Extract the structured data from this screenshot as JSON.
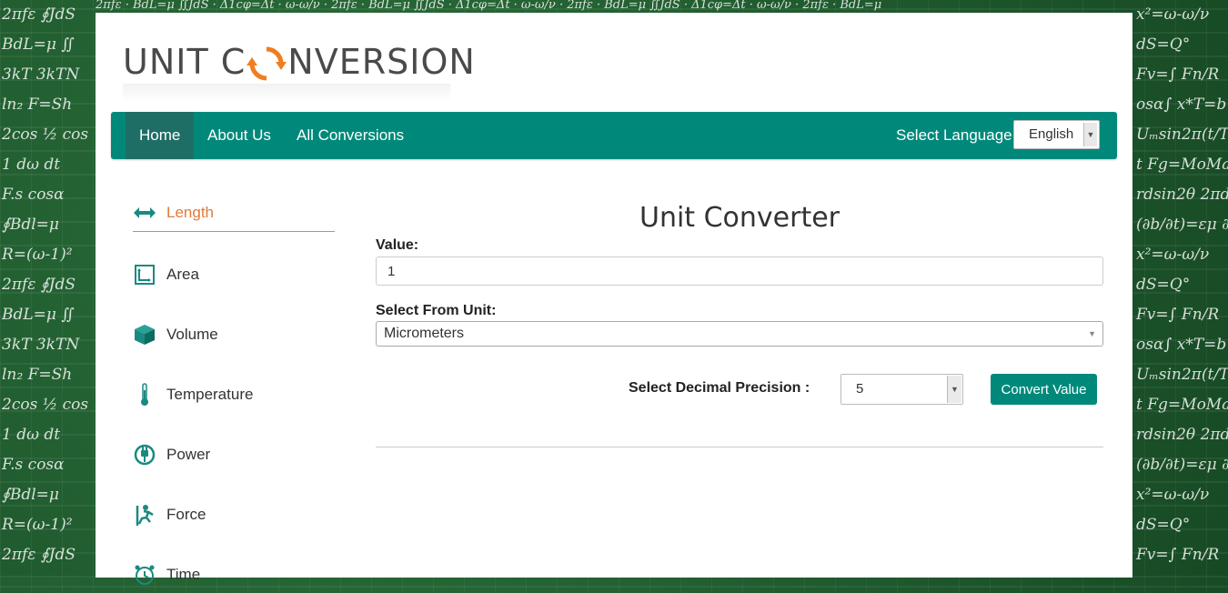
{
  "logo": {
    "text_before": "UNIT C",
    "text_after": "NVERSION"
  },
  "navbar": {
    "items": [
      {
        "label": "Home",
        "active": true
      },
      {
        "label": "About Us"
      },
      {
        "label": "All Conversions"
      }
    ],
    "language_label": "Select Language",
    "language_value": "English"
  },
  "sidebar": {
    "items": [
      {
        "label": "Length",
        "icon": "arrows-horizontal-icon",
        "active": true
      },
      {
        "label": "Area",
        "icon": "area-icon"
      },
      {
        "label": "Volume",
        "icon": "cube-icon"
      },
      {
        "label": "Temperature",
        "icon": "thermometer-icon"
      },
      {
        "label": "Power",
        "icon": "plug-icon"
      },
      {
        "label": "Force",
        "icon": "force-icon"
      },
      {
        "label": "Time",
        "icon": "clock-icon"
      }
    ]
  },
  "converter": {
    "title": "Unit Converter",
    "value_label": "Value:",
    "value": "1",
    "from_unit_label": "Select From Unit:",
    "from_unit": "Micrometers",
    "precision_label": "Select Decimal Precision :",
    "precision": "5",
    "convert_button": "Convert Value"
  },
  "colors": {
    "accent": "#00897b",
    "active_nav": "#1f6e66",
    "sidebar_active": "#e07b39",
    "logo_orange": "#f07d20"
  }
}
